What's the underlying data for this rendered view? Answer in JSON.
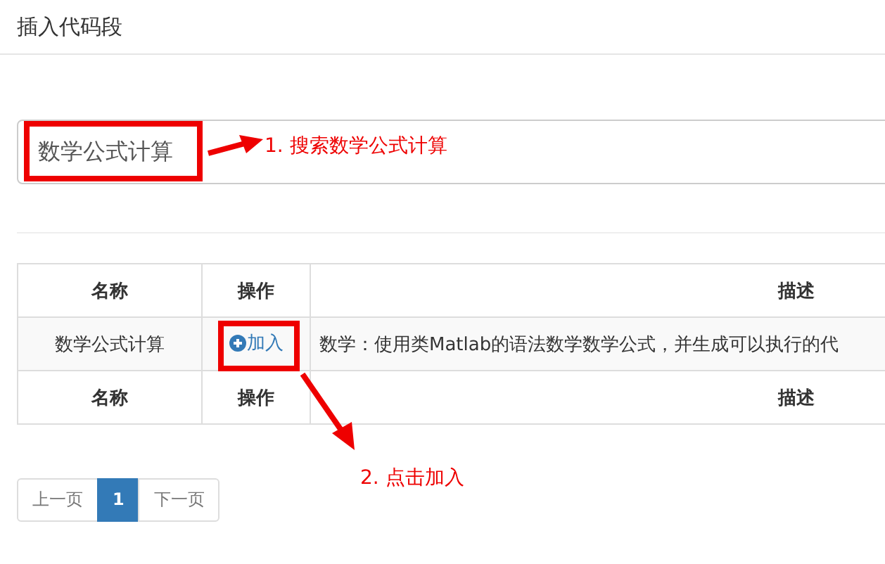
{
  "header": {
    "title": "插入代码段"
  },
  "search": {
    "value": "数学公式计算"
  },
  "table": {
    "columns": [
      "名称",
      "操作",
      "描述"
    ],
    "rows": [
      {
        "name": "数学公式计算",
        "action": "加入",
        "description": "数学：使用类Matlab的语法数学数学公式，并生成可以执行的代"
      }
    ],
    "footer_columns": [
      "名称",
      "操作",
      "描述"
    ]
  },
  "pagination": [
    {
      "label": "上一页",
      "selected": false
    },
    {
      "label": "1",
      "selected": true
    },
    {
      "label": "下一页",
      "selected": false
    }
  ],
  "annotations": [
    {
      "text": "1. 搜索数学公式计算"
    },
    {
      "text": "2. 点击加入"
    }
  ]
}
